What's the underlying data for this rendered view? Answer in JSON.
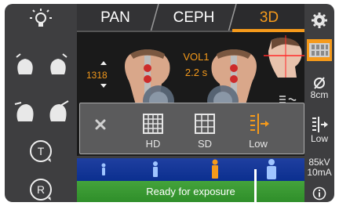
{
  "tabs": [
    {
      "label": "PAN",
      "active": false
    },
    {
      "label": "CEPH",
      "active": false
    },
    {
      "label": "3D",
      "active": true
    }
  ],
  "main": {
    "program": "VOL1",
    "exposure_time": "2.2 s",
    "height_value": "1318"
  },
  "popup": {
    "items": [
      {
        "label": "",
        "icon": "close-icon"
      },
      {
        "label": "HD",
        "icon": "grid-hd-icon"
      },
      {
        "label": "SD",
        "icon": "grid-sd-icon"
      },
      {
        "label": "Low",
        "icon": "dose-low-icon",
        "selected": true
      }
    ]
  },
  "right": {
    "fov_label": "8cm",
    "dose_label": "Low",
    "kv": "85kV",
    "ma": "10mA"
  },
  "status": {
    "message": "Ready for exposure"
  },
  "colors": {
    "accent": "#f59a1b",
    "status_green": "#3a9c32",
    "patient_blue": "#1a3c9c",
    "panel": "#3e3e40"
  }
}
